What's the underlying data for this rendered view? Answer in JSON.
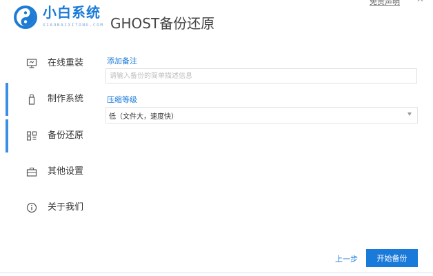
{
  "header": {
    "brand_name": "小白系统",
    "brand_sub": "XIAOBAIXITONG.COM",
    "page_title": "GHOST备份还原",
    "top_link": "免责声明",
    "minimize": "—",
    "close": "✕"
  },
  "sidebar": {
    "items": [
      {
        "label": "在线重装",
        "icon": "monitor-icon"
      },
      {
        "label": "制作系统",
        "icon": "usb-drive-icon"
      },
      {
        "label": "备份还原",
        "icon": "backup-restore-icon"
      },
      {
        "label": "其他设置",
        "icon": "toolbox-icon"
      },
      {
        "label": "关于我们",
        "icon": "info-icon"
      }
    ]
  },
  "form": {
    "note_label": "添加备注",
    "note_placeholder": "请输入备份的简单描述信息",
    "note_value": "",
    "compress_label": "压缩等级",
    "compress_value": "低（文件大，速度快）"
  },
  "footer": {
    "prev_label": "上一步",
    "start_label": "开始备份"
  },
  "colors": {
    "accent": "#1a7ad9",
    "active_bar": "#3a8ee6"
  }
}
